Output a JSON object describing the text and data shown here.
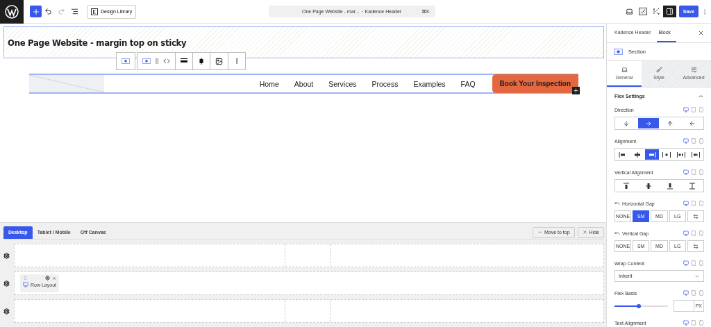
{
  "topbar": {
    "design_library": "Design Library",
    "document_title": "One Page Website - mar...",
    "document_type": "· Kadence Header",
    "shortcut": "⌘K",
    "save": "Save"
  },
  "canvas": {
    "title": "One Page Website - margin top on sticky",
    "nav": [
      "Home",
      "About",
      "Services",
      "Process",
      "Examples",
      "FAQ"
    ],
    "cta": "Book Your Inspection"
  },
  "builder": {
    "tabs": [
      {
        "label": "Desktop",
        "selected": true
      },
      {
        "label": "Tablet / Mobile",
        "selected": false
      },
      {
        "label": "Off Canvas",
        "selected": false
      }
    ],
    "move_to_top": "Move to top",
    "hide": "Hide",
    "rows": [
      {
        "kind": "columns"
      },
      {
        "kind": "widget",
        "widget": "Row Layout"
      },
      {
        "kind": "columns"
      }
    ]
  },
  "sidebar": {
    "tabs": [
      {
        "label": "Kadence Header",
        "selected": false
      },
      {
        "label": "Block",
        "selected": true
      }
    ],
    "block_name": "Section",
    "panel_tabs": [
      {
        "label": "General",
        "selected": true
      },
      {
        "label": "Style",
        "selected": false
      },
      {
        "label": "Advanced",
        "selected": false
      }
    ],
    "section_title": "Flex Settings",
    "settings": [
      {
        "kind": "icons",
        "label": "Direction",
        "options": [
          {
            "selected": false
          },
          {
            "selected": true
          },
          {
            "selected": false
          },
          {
            "selected": false
          }
        ]
      },
      {
        "kind": "icons",
        "label": "Alignment",
        "options": [
          {
            "selected": false
          },
          {
            "selected": false
          },
          {
            "selected": true
          },
          {
            "selected": false
          },
          {
            "selected": false
          },
          {
            "selected": false
          }
        ]
      },
      {
        "kind": "icons",
        "label": "Vertical Alignment",
        "options": [
          {
            "selected": false
          },
          {
            "selected": false
          },
          {
            "selected": false
          },
          {
            "selected": false
          }
        ]
      },
      {
        "kind": "sizes",
        "label": "Horizontal Gap",
        "options": [
          {
            "label": "NONE",
            "selected": false
          },
          {
            "label": "SM",
            "selected": true
          },
          {
            "label": "MD",
            "selected": false
          },
          {
            "label": "LG",
            "selected": false
          }
        ]
      },
      {
        "kind": "sizes",
        "label": "Vertical Gap",
        "options": [
          {
            "label": "NONE",
            "selected": false
          },
          {
            "label": "SM",
            "selected": false
          },
          {
            "label": "MD",
            "selected": false
          },
          {
            "label": "LG",
            "selected": false
          }
        ]
      },
      {
        "kind": "select",
        "label": "Wrap Content",
        "value": "Inherit"
      },
      {
        "kind": "slider",
        "label": "Flex Basis",
        "level": 0.45,
        "unit": "PX"
      },
      {
        "kind": "heading",
        "label": "Text Alignment"
      }
    ]
  }
}
